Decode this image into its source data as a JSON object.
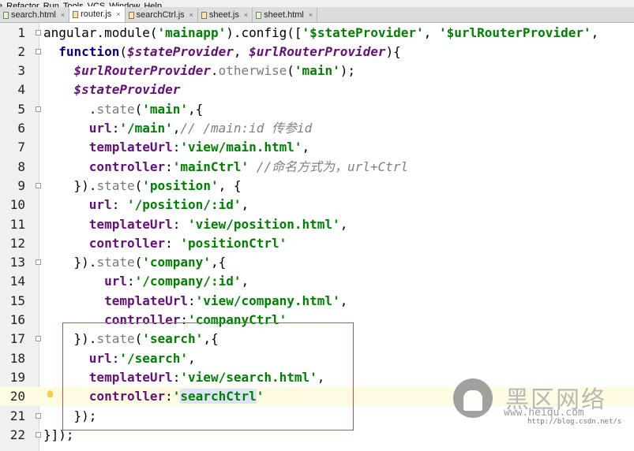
{
  "menu": [
    "e",
    "Refactor",
    "Run",
    "Tools",
    "VCS",
    "Window",
    "Help"
  ],
  "tabs": [
    {
      "label": "search.html",
      "type": "html",
      "active": false
    },
    {
      "label": "router.js",
      "type": "js",
      "active": true
    },
    {
      "label": "searchCtrl.js",
      "type": "js",
      "active": false
    },
    {
      "label": "sheet.js",
      "type": "js",
      "active": false
    },
    {
      "label": "sheet.html",
      "type": "html",
      "active": false
    }
  ],
  "tab_close_glyph": "×",
  "lines": [
    {
      "n": "1",
      "fold": true,
      "tokens": [
        [
          "plain",
          "angular.module("
        ],
        [
          "str",
          "'"
        ],
        [
          "str",
          "mainapp"
        ],
        [
          "str",
          "'"
        ],
        [
          "plain",
          ").config(["
        ],
        [
          "str",
          "'$stateProvider'"
        ],
        [
          "plain",
          ", "
        ],
        [
          "str",
          "'$urlRouterProvider'"
        ],
        [
          "plain",
          ","
        ]
      ]
    },
    {
      "n": "2",
      "fold": true,
      "tokens": [
        [
          "plain",
          "  "
        ],
        [
          "kw",
          "function"
        ],
        [
          "plain",
          "("
        ],
        [
          "param",
          "$stateProvider"
        ],
        [
          "plain",
          ", "
        ],
        [
          "param",
          "$urlRouterProvider"
        ],
        [
          "plain",
          "){"
        ]
      ]
    },
    {
      "n": "3",
      "fold": false,
      "tokens": [
        [
          "plain",
          "    "
        ],
        [
          "param",
          "$urlRouterProvider"
        ],
        [
          "plain",
          "."
        ],
        [
          "meth",
          "otherwise"
        ],
        [
          "plain",
          "("
        ],
        [
          "str",
          "'main'"
        ],
        [
          "plain",
          ");"
        ]
      ]
    },
    {
      "n": "4",
      "fold": false,
      "tokens": [
        [
          "plain",
          "    "
        ],
        [
          "param",
          "$stateProvider"
        ]
      ]
    },
    {
      "n": "5",
      "fold": true,
      "tokens": [
        [
          "plain",
          "      ."
        ],
        [
          "meth",
          "state"
        ],
        [
          "plain",
          "("
        ],
        [
          "str",
          "'main'"
        ],
        [
          "plain",
          ",{"
        ]
      ]
    },
    {
      "n": "6",
      "fold": false,
      "tokens": [
        [
          "plain",
          "      "
        ],
        [
          "prop",
          "url"
        ],
        [
          "plain",
          ":"
        ],
        [
          "str",
          "'/main'"
        ],
        [
          "plain",
          ","
        ],
        [
          "cmt",
          "// /main:id 传参id"
        ]
      ]
    },
    {
      "n": "7",
      "fold": false,
      "tokens": [
        [
          "plain",
          "      "
        ],
        [
          "prop",
          "templateUrl"
        ],
        [
          "plain",
          ":"
        ],
        [
          "str",
          "'view/main.html'"
        ],
        [
          "plain",
          ","
        ]
      ]
    },
    {
      "n": "8",
      "fold": false,
      "tokens": [
        [
          "plain",
          "      "
        ],
        [
          "prop",
          "controller"
        ],
        [
          "plain",
          ":"
        ],
        [
          "str",
          "'mainCtrl'"
        ],
        [
          "plain",
          " "
        ],
        [
          "cmt",
          "//命名方式为，url+Ctrl"
        ]
      ]
    },
    {
      "n": "9",
      "fold": true,
      "tokens": [
        [
          "plain",
          "    })."
        ],
        [
          "meth",
          "state"
        ],
        [
          "plain",
          "("
        ],
        [
          "str",
          "'position'"
        ],
        [
          "plain",
          ", {"
        ]
      ]
    },
    {
      "n": "10",
      "fold": false,
      "tokens": [
        [
          "plain",
          "      "
        ],
        [
          "prop",
          "url"
        ],
        [
          "plain",
          ": "
        ],
        [
          "str",
          "'/position/:id'"
        ],
        [
          "plain",
          ","
        ]
      ]
    },
    {
      "n": "11",
      "fold": false,
      "tokens": [
        [
          "plain",
          "      "
        ],
        [
          "prop",
          "templateUrl"
        ],
        [
          "plain",
          ": "
        ],
        [
          "str",
          "'view/position.html'"
        ],
        [
          "plain",
          ","
        ]
      ]
    },
    {
      "n": "12",
      "fold": false,
      "tokens": [
        [
          "plain",
          "      "
        ],
        [
          "prop",
          "controller"
        ],
        [
          "plain",
          ": "
        ],
        [
          "str",
          "'positionCtrl'"
        ]
      ]
    },
    {
      "n": "13",
      "fold": true,
      "tokens": [
        [
          "plain",
          "    })."
        ],
        [
          "meth",
          "state"
        ],
        [
          "plain",
          "("
        ],
        [
          "str",
          "'company'"
        ],
        [
          "plain",
          ",{"
        ]
      ]
    },
    {
      "n": "14",
      "fold": false,
      "tokens": [
        [
          "plain",
          "        "
        ],
        [
          "prop",
          "url"
        ],
        [
          "plain",
          ":"
        ],
        [
          "str",
          "'/company/:id'"
        ],
        [
          "plain",
          ","
        ]
      ]
    },
    {
      "n": "15",
      "fold": false,
      "tokens": [
        [
          "plain",
          "        "
        ],
        [
          "prop",
          "templateUrl"
        ],
        [
          "plain",
          ":"
        ],
        [
          "str",
          "'view/company.html'"
        ],
        [
          "plain",
          ","
        ]
      ]
    },
    {
      "n": "16",
      "fold": false,
      "tokens": [
        [
          "plain",
          "        "
        ],
        [
          "prop",
          "controller"
        ],
        [
          "plain",
          ":"
        ],
        [
          "str",
          "'companyCtrl'"
        ]
      ]
    },
    {
      "n": "17",
      "fold": true,
      "tokens": [
        [
          "plain",
          "    })."
        ],
        [
          "meth",
          "state"
        ],
        [
          "plain",
          "("
        ],
        [
          "str",
          "'search'"
        ],
        [
          "plain",
          ",{"
        ]
      ]
    },
    {
      "n": "18",
      "fold": false,
      "tokens": [
        [
          "plain",
          "      "
        ],
        [
          "prop",
          "url"
        ],
        [
          "plain",
          ":"
        ],
        [
          "str",
          "'/search'"
        ],
        [
          "plain",
          ","
        ]
      ]
    },
    {
      "n": "19",
      "fold": false,
      "tokens": [
        [
          "plain",
          "      "
        ],
        [
          "prop",
          "templateUrl"
        ],
        [
          "plain",
          ":"
        ],
        [
          "str",
          "'view/search.html'"
        ],
        [
          "plain",
          ","
        ]
      ]
    },
    {
      "n": "20",
      "fold": false,
      "current": true,
      "bulb": true,
      "tokens": [
        [
          "plain",
          "      "
        ],
        [
          "prop",
          "controller"
        ],
        [
          "plain",
          ":"
        ],
        [
          "str",
          "'"
        ],
        [
          "hlstr",
          "searchCtrl"
        ],
        [
          "str",
          "'"
        ]
      ]
    },
    {
      "n": "21",
      "fold": true,
      "tokens": [
        [
          "plain",
          "    });"
        ]
      ]
    },
    {
      "n": "22",
      "fold": true,
      "tokens": [
        [
          "plain",
          "}]);"
        ]
      ]
    }
  ],
  "watermark": {
    "title": "黑区网络",
    "url": "www.heiqu.com",
    "url2": "http://blog.csdn.net/s"
  },
  "colors": {
    "keyword": "#000080",
    "string": "#008000",
    "property": "#660e7a",
    "comment": "#808080",
    "selection_box": "#dd4444"
  }
}
